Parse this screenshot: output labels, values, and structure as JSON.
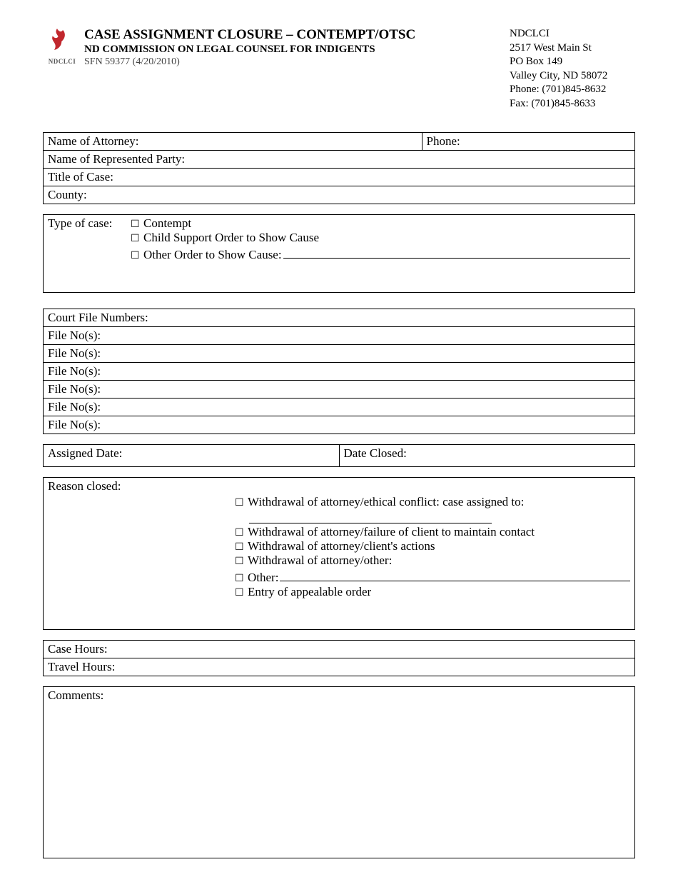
{
  "header": {
    "title": "CASE ASSIGNMENT CLOSURE – CONTEMPT/OTSC",
    "subtitle": "ND COMMISSION ON LEGAL COUNSEL FOR INDIGENTS",
    "sfn": "SFN 59377 (4/20/2010)",
    "org": "NDCLCI",
    "addr1": "2517 West Main St",
    "addr2": "PO Box 149",
    "addr3": "Valley City, ND 58072",
    "phone": "Phone: (701)845-8632",
    "fax": "Fax: (701)845-8633",
    "logo_label": "NDCLCI"
  },
  "attorney": {
    "name_label": "Name of Attorney:",
    "phone_label": "Phone:",
    "party_label": "Name of Represented Party:",
    "title_label": "Title of Case:",
    "county_label": "County:"
  },
  "type": {
    "label": "Type of case:",
    "opt1": "Contempt",
    "opt2": "Child Support Order to Show Cause",
    "opt3": "Other Order to Show Cause:"
  },
  "files": {
    "header": "Court File Numbers:",
    "row": "File No(s):"
  },
  "dates": {
    "assigned": "Assigned Date:",
    "closed": "Date Closed:"
  },
  "reason": {
    "label": "Reason closed:",
    "r1": "Withdrawal of attorney/ethical conflict: case assigned to:",
    "r2": "Withdrawal of attorney/failure of client to maintain contact",
    "r3": "Withdrawal of attorney/client's actions",
    "r4": "Withdrawal of attorney/other:",
    "r5": "Other:",
    "r6": "Entry of appealable order"
  },
  "hours": {
    "case": "Case Hours:",
    "travel": "Travel Hours:"
  },
  "comments": {
    "label": "Comments:"
  },
  "sym": {
    "box": "☐"
  }
}
